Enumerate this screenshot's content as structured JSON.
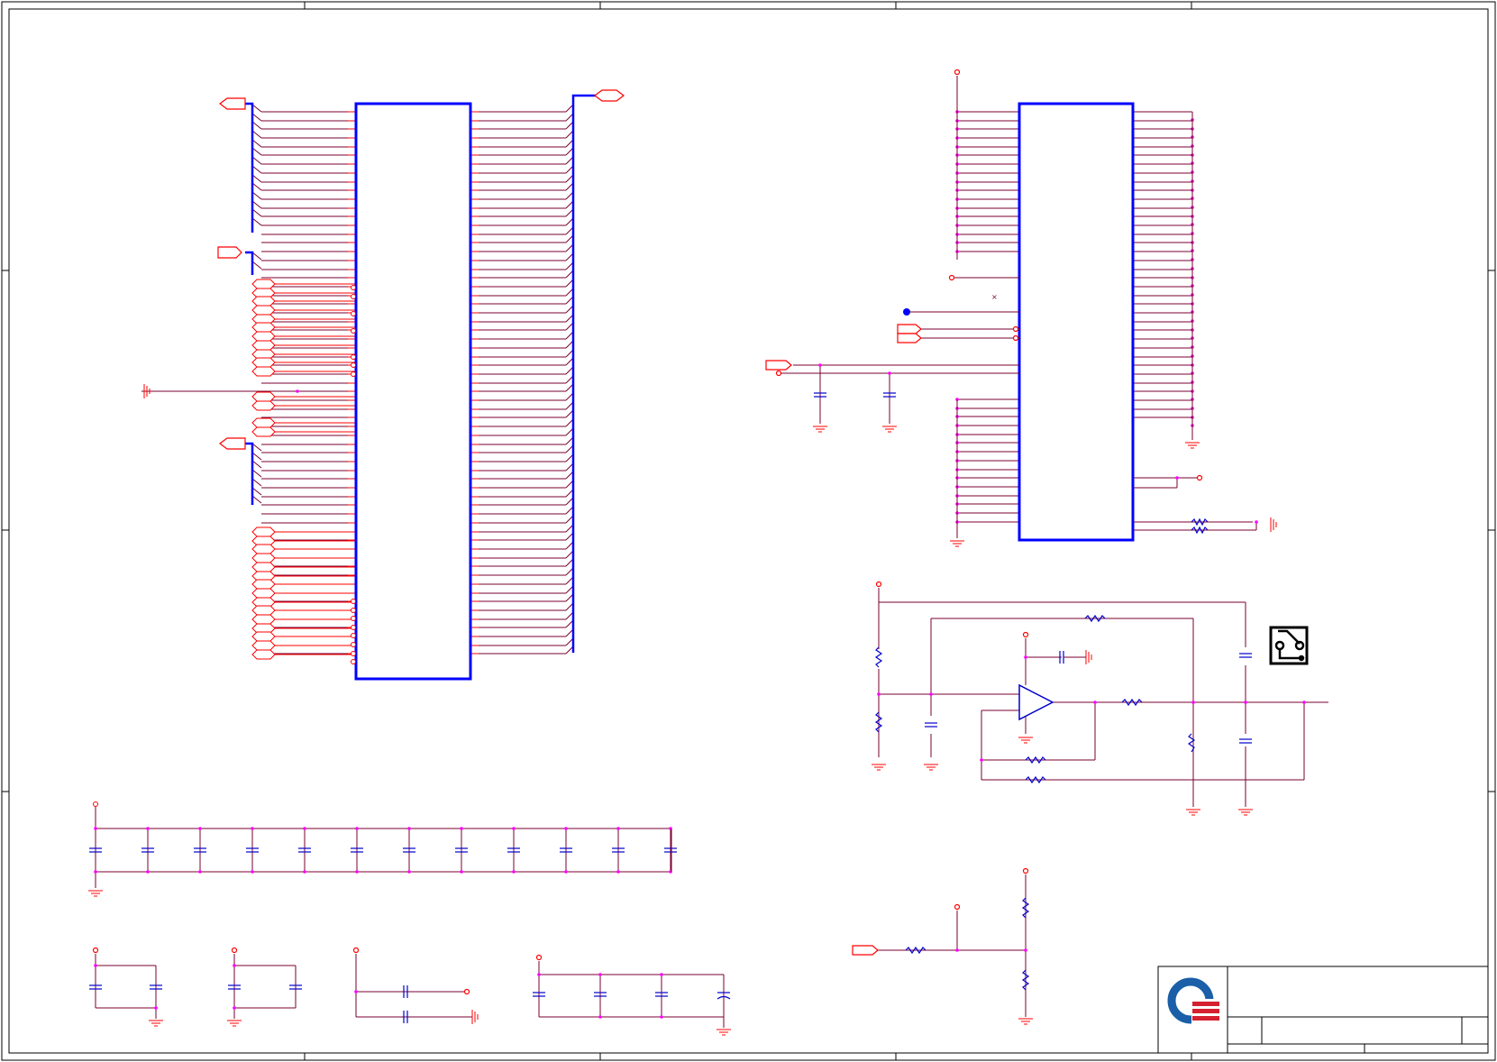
{
  "title_block": {
    "title": "",
    "size": "",
    "document_number": "",
    "revision": "",
    "date": "",
    "sheet": ""
  },
  "colors": {
    "frame": "#000000",
    "wire": "#7a0030",
    "pin": "#ff0000",
    "ic_body": "#0000ff",
    "junction": "#ff00ff",
    "bus": "#0000ff",
    "passive": "#0000cc",
    "logo_blue": "#1a5fa8",
    "logo_red": "#d42030"
  },
  "icons": [
    "company-logo-icon",
    "pcb-board-icon",
    "ground-icon",
    "power-pin-icon",
    "port-arrow-icon"
  ]
}
